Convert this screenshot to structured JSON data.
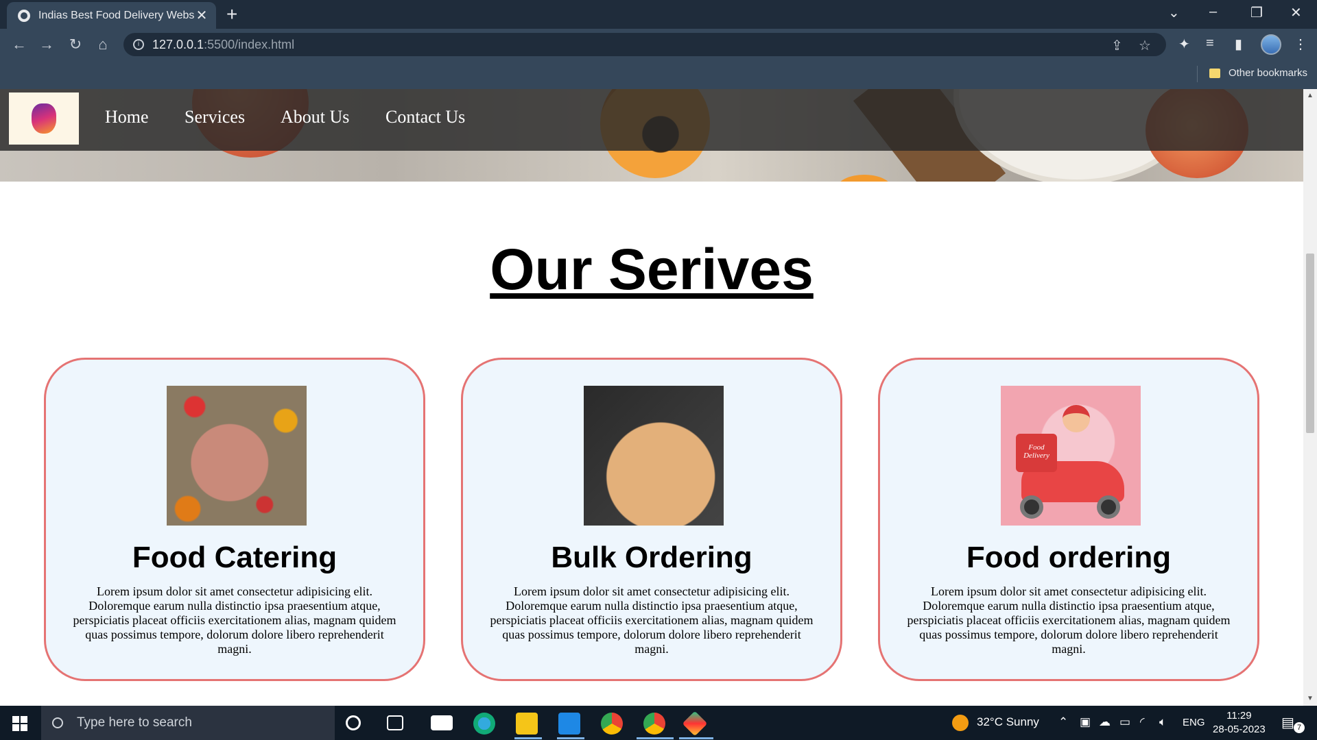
{
  "browser": {
    "tab_title": "Indias Best Food Delivery Website",
    "tab_close": "✕",
    "new_tab": "+",
    "url_host": "127.0.0.1",
    "url_path": ":5500/index.html",
    "other_bookmarks": "Other bookmarks"
  },
  "nav": {
    "items": [
      "Home",
      "Services",
      "About Us",
      "Contact Us"
    ]
  },
  "section": {
    "heading": "Our Serives"
  },
  "cards": [
    {
      "title": "Food Catering",
      "text": "Lorem ipsum dolor sit amet consectetur adipisicing elit. Doloremque earum nulla distinctio ipsa praesentium atque, perspiciatis placeat officiis exercitationem alias, magnam quidem quas possimus tempore, dolorum dolore libero reprehenderit magni."
    },
    {
      "title": "Bulk Ordering",
      "text": "Lorem ipsum dolor sit amet consectetur adipisicing elit. Doloremque earum nulla distinctio ipsa praesentium atque, perspiciatis placeat officiis exercitationem alias, magnam quidem quas possimus tempore, dolorum dolore libero reprehenderit magni."
    },
    {
      "title": "Food ordering",
      "text": "Lorem ipsum dolor sit amet consectetur adipisicing elit. Doloremque earum nulla distinctio ipsa praesentium atque, perspiciatis placeat officiis exercitationem alias, magnam quidem quas possimus tempore, dolorum dolore libero reprehenderit magni.",
      "image_text": "Food Delivery"
    }
  ],
  "taskbar": {
    "search_placeholder": "Type here to search",
    "weather": "32°C  Sunny",
    "lang": "ENG",
    "time": "11:29",
    "date": "28-05-2023",
    "notif_count": "7"
  },
  "colors": {
    "card_border": "#e57373",
    "card_bg": "#eef6fd",
    "navbar_bg": "#282828",
    "chrome_bg": "#35475a"
  }
}
